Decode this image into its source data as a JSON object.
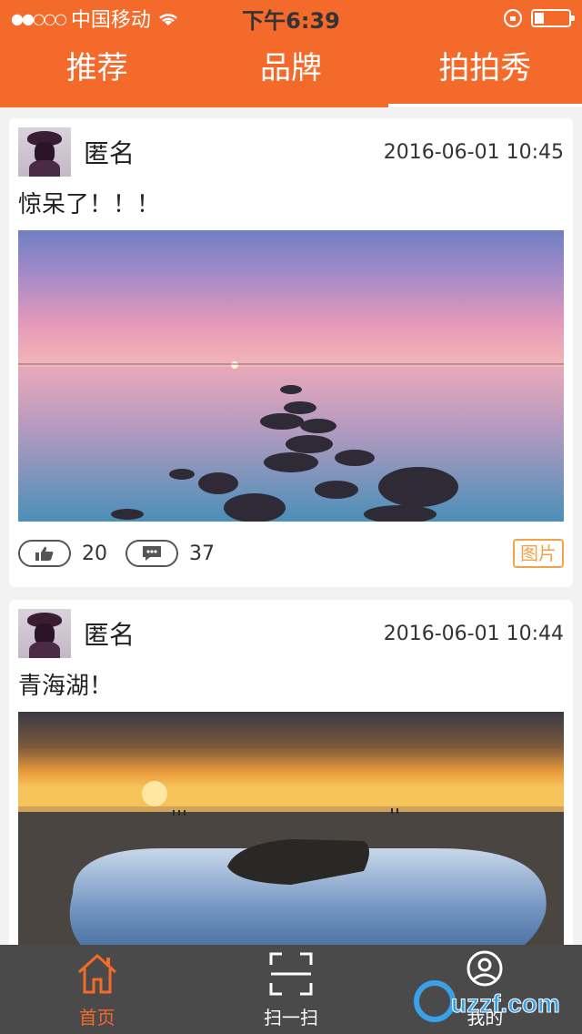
{
  "status_bar": {
    "signal": "●●○○○",
    "carrier": "中国移动",
    "time": "下午6:39"
  },
  "tabs": [
    {
      "label": "推荐"
    },
    {
      "label": "品牌"
    },
    {
      "label": "拍拍秀",
      "active": true
    }
  ],
  "posts": [
    {
      "user": "匿名",
      "time": "2016-06-01 10:45",
      "text": "惊呆了！！！",
      "likes": "20",
      "comments": "37",
      "tag": "图片"
    },
    {
      "user": "匿名",
      "time": "2016-06-01 10:44",
      "text": "青海湖！"
    }
  ],
  "bottom_nav": [
    {
      "label": "首页",
      "icon": "home-icon",
      "active": true
    },
    {
      "label": "扫一扫",
      "icon": "scan-icon"
    },
    {
      "label": "我的",
      "icon": "profile-icon"
    }
  ],
  "watermark": "uzzf.com",
  "colors": {
    "accent": "#f46a2b",
    "nav_bg": "#4a4a4a",
    "tag": "#f3a24a"
  }
}
